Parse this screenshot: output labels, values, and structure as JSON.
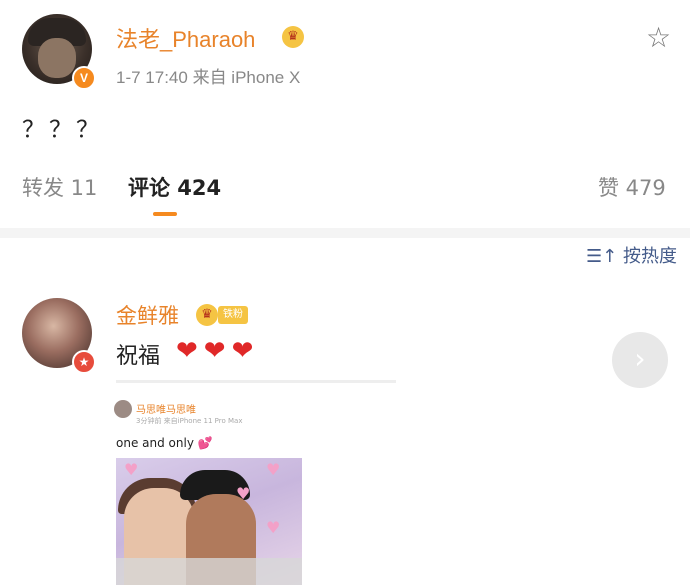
{
  "post": {
    "username": "法老_Pharaoh",
    "verified_badge": "V",
    "time": "1-7 17:40",
    "source": "来自 iPhone X",
    "text": "？？？"
  },
  "tabs": {
    "repost": "转发 11",
    "comment": "评论 424",
    "like": "赞 479"
  },
  "sort": {
    "label": "按热度"
  },
  "comment": {
    "username": "金鲜雅",
    "fan_badge": "铁粉",
    "text": "祝福",
    "hearts": "❤❤❤"
  },
  "embedded": {
    "username": "马思唯马思唯",
    "meta": "3分钟前  来自iPhone 11 Pro Max",
    "text": "one and only",
    "gem": "💕"
  },
  "icons": {
    "star": "star-outline-icon",
    "sort": "sort-icon",
    "next": "chevron-right-icon"
  },
  "colors": {
    "accent": "#f58a1f",
    "username": "#e8832a",
    "heart": "#e02828",
    "link": "#445b8a"
  }
}
